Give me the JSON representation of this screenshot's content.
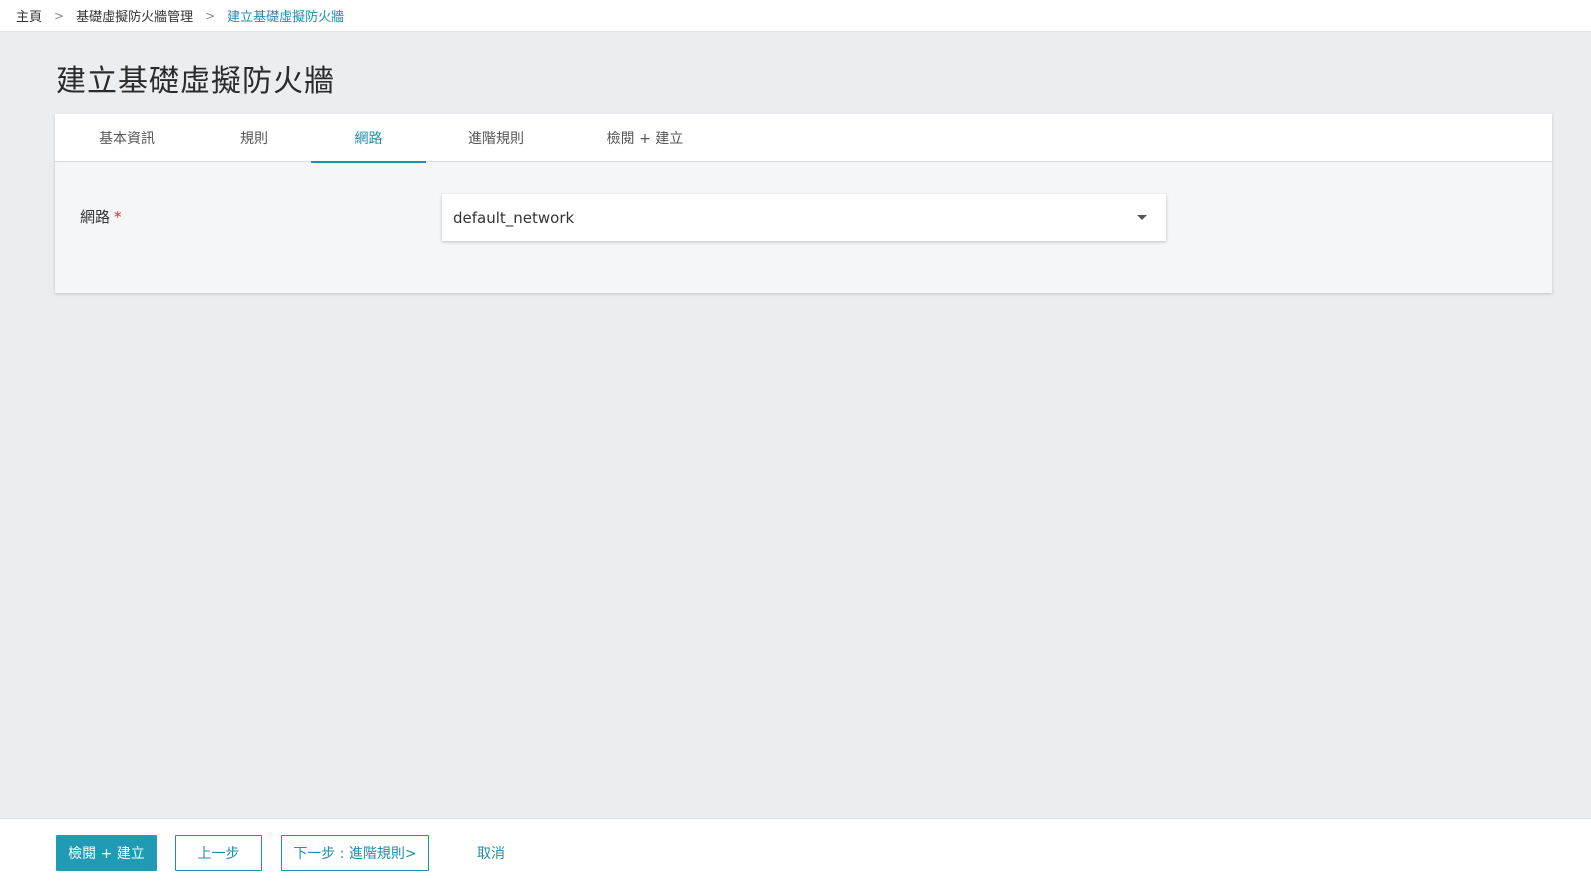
{
  "breadcrumb": {
    "items": [
      "主頁",
      "基礎虛擬防火牆管理",
      "建立基礎虛擬防火牆"
    ],
    "separator": ">"
  },
  "page": {
    "title": "建立基礎虛擬防火牆"
  },
  "tabs": [
    {
      "label": "基本資訊"
    },
    {
      "label": "規則"
    },
    {
      "label": "網路"
    },
    {
      "label": "進階規則"
    },
    {
      "label": "檢閱 + 建立"
    }
  ],
  "active_tab": "網路",
  "form": {
    "network": {
      "label": "網路",
      "required_marker": "*",
      "value": "default_network"
    }
  },
  "footer": {
    "review_create": "檢閱 + 建立",
    "previous": "上一步",
    "next": "下一步 : 進階規則>",
    "cancel": "取消"
  },
  "colors": {
    "accent": "#1f8fa8",
    "primary_button": "#1f9bb5",
    "background": "#ebeef1",
    "required": "#d0342c"
  },
  "icons": {
    "dropdown": "caret-down-icon"
  }
}
